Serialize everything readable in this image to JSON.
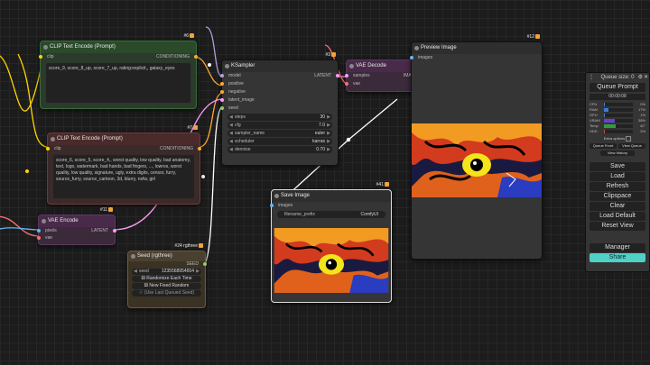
{
  "nodes": {
    "clip_pos": {
      "badge": "#6",
      "title": "CLIP Text Encode (Prompt)",
      "in_clip": "clip",
      "out": "CONDITIONING",
      "text": "score_9, score_8_up, score_7_up, rating:explicit,, galaxy_eyes"
    },
    "clip_neg": {
      "badge": "#7",
      "title": "CLIP Text Encode (Prompt)",
      "in_clip": "clip",
      "out": "CONDITIONING",
      "text": "score_6, score_5, score_4,, worst quality, low quality, bad anatomy, text, logo, watermark, bad hands, bad fingers, ..., lowres, worst quality, low quality, signature, ugly, extra digits, censor, furry, source_furry, source_cartoon, 3d, blurry, nsfw, girl"
    },
    "ksampler": {
      "badge": "#3",
      "title": "KSampler",
      "inputs": [
        "model",
        "positive",
        "negative",
        "latent_image",
        "seed"
      ],
      "out": "LATENT",
      "widgets": [
        {
          "label": "steps",
          "value": "30"
        },
        {
          "label": "cfg",
          "value": "7.0"
        },
        {
          "label": "sampler_name",
          "value": "euler"
        },
        {
          "label": "scheduler",
          "value": "karras"
        },
        {
          "label": "denoise",
          "value": "0.70"
        }
      ]
    },
    "vae_decode": {
      "badge": "#8",
      "title": "VAE Decode",
      "in1": "samples",
      "in2": "vae",
      "out": "IMAGE"
    },
    "preview": {
      "badge": "#12",
      "title": "Preview Image",
      "in": "images"
    },
    "save": {
      "badge": "#41",
      "title": "Save Image",
      "in": "images",
      "prefix_label": "filename_prefix",
      "prefix_value": "ComfyUI"
    },
    "vae_encode": {
      "badge": "#11",
      "title": "VAE Encode",
      "in1": "pixels",
      "in2": "vae",
      "out": "LATENT"
    },
    "seed": {
      "badge": "#24 rgthree",
      "title": "Seed (rgthree)",
      "out": "SEED",
      "seed_label": "seed",
      "seed_value": "1235568954654",
      "btn1": "Randomize Each Time",
      "btn2": "New Fixed Random",
      "btn3": "(Use Last Queued Seed)"
    }
  },
  "panel": {
    "queue_size": "Queue size: 0",
    "queue_prompt": "Queue Prompt",
    "timer": "00:00:08",
    "sys": [
      {
        "name": "CPU",
        "pct": "0%",
        "level": 0.02,
        "color": "#3a7bd5"
      },
      {
        "name": "RAM",
        "pct": "17%",
        "level": 0.17,
        "color": "#3a7bd5"
      },
      {
        "name": "GPU",
        "pct": "1%",
        "level": 0.01,
        "color": "#3a7bd5"
      },
      {
        "name": "VRAM",
        "pct": "38%",
        "level": 0.38,
        "color": "#6a3fd0"
      },
      {
        "name": "Temp",
        "pct": "42°",
        "level": 0.42,
        "color": "#2e9e3e"
      },
      {
        "name": "HDD",
        "pct": "2%",
        "level": 0.02,
        "color": "#c14a4a"
      }
    ],
    "extra_options": "Extra options",
    "queue_front": "Queue Front",
    "view_queue": "View Queue",
    "view_history": "View History",
    "buttons": [
      "Save",
      "Load",
      "Refresh",
      "Clipspace",
      "Clear",
      "Load Default",
      "Reset View"
    ],
    "manager": "Manager",
    "share": "Share"
  }
}
